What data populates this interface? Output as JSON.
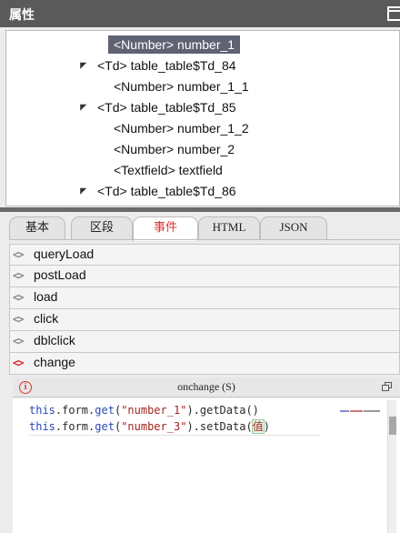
{
  "panel": {
    "title": "属性"
  },
  "tree": {
    "nodes": [
      {
        "label": "<Number> number_1",
        "selected": true
      },
      {
        "label": "<Td> table_table$Td_84",
        "expandable": true
      },
      {
        "label": "<Number> number_1_1"
      },
      {
        "label": "<Td> table_table$Td_85",
        "expandable": true
      },
      {
        "label": "<Number> number_1_2"
      },
      {
        "label": "<Number> number_2"
      },
      {
        "label": "<Textfield> textfield"
      },
      {
        "label": "<Td> table_table$Td_86",
        "expandable": true
      }
    ]
  },
  "tabs": [
    "基本",
    "区段",
    "事件",
    "HTML",
    "JSON"
  ],
  "active_tab": "事件",
  "events": [
    "queryLoad",
    "postLoad",
    "load",
    "click",
    "dblclick",
    "change"
  ],
  "active_event": "change",
  "editor": {
    "header": "onchange (S)",
    "line1": {
      "a": "this",
      "b": ".form.",
      "c": "get",
      "d": "(",
      "e": "\"number_1\"",
      "f": ").getData()"
    },
    "line2": {
      "a": "this",
      "b": ".form.",
      "c": "get",
      "d": "(",
      "e": "\"number_3\"",
      "f": ").setData(",
      "g": "值",
      "h": ")"
    }
  },
  "colors": {
    "accent": "#d33333",
    "selection": "#5e6273",
    "titlebar": "#5a5a5a"
  }
}
